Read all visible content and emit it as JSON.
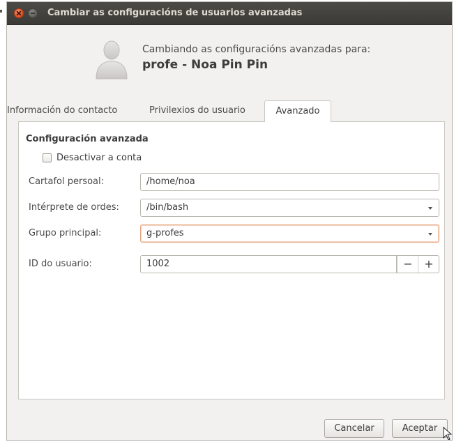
{
  "window": {
    "title": "Cambiar as configuracións de usuarios avanzadas"
  },
  "header": {
    "subtitle": "Cambiando as configuracións avanzadas para:",
    "user_name": "profe - Noa Pin Pin"
  },
  "tabs": [
    {
      "label": "Información do contacto",
      "active": false
    },
    {
      "label": "Privilexios do usuario",
      "active": false
    },
    {
      "label": "Avanzado",
      "active": true
    }
  ],
  "advanced": {
    "section_title": "Configuración avanzada",
    "disable_account": {
      "label": "Desactivar a conta",
      "checked": false
    },
    "home_folder": {
      "label": "Cartafol persoal:",
      "value": "/home/noa"
    },
    "shell": {
      "label": "Intérprete de ordes:",
      "value": "/bin/bash"
    },
    "main_group": {
      "label": "Grupo principal:",
      "value": "g-profes"
    },
    "user_id": {
      "label": "ID do usuario:",
      "value": "1002",
      "decrement": "−",
      "increment": "+"
    }
  },
  "buttons": {
    "cancel": "Cancelar",
    "accept": "Aceptar"
  },
  "icons": {
    "close": "close-icon",
    "minimize": "minimize-icon",
    "avatar": "user-avatar-icon",
    "dropdown": "chevron-down-icon",
    "cursor": "mouse-pointer-icon"
  },
  "colors": {
    "titlebar": "#3f3e39",
    "close_button": "#df4a1c",
    "focus_border": "#e6a37f",
    "window_bg": "#f2f1f0"
  }
}
